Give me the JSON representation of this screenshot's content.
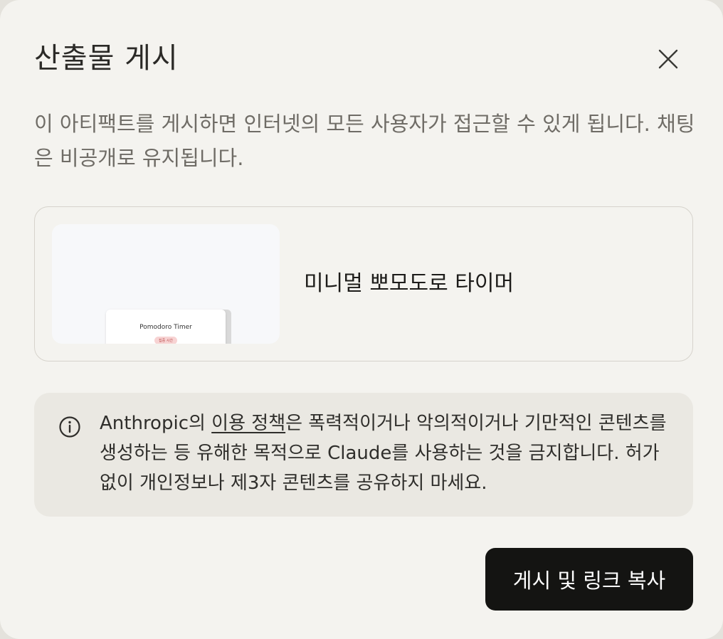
{
  "dialog": {
    "title": "산출물 게시",
    "close_icon": "close-icon",
    "description": "이 아티팩트를 게시하면 인터넷의 모든 사용자가 접근할 수 있게 됩니다. 채팅은 비공개로 유지됩니다."
  },
  "artifact": {
    "name": "미니멀 뽀모도로 타이머",
    "thumbnail": {
      "title": "Pomodoro Timer",
      "badge": "집중 시간"
    }
  },
  "notice": {
    "icon": "info-icon",
    "prefix": "Anthropic의 ",
    "link_text": "이용 정책",
    "suffix": "은 폭력적이거나 악의적이거나 기만적인 콘텐츠를 생성하는 등 유해한 목적으로 Claude를 사용하는 것을 금지합니다. 허가 없이 개인정보나 제3자 콘텐츠를 공유하지 마세요."
  },
  "actions": {
    "publish_label": "게시 및 링크 복사"
  },
  "colors": {
    "background": "#f4f3ef",
    "button": "#141412",
    "notice_bg": "#eae8e2"
  }
}
